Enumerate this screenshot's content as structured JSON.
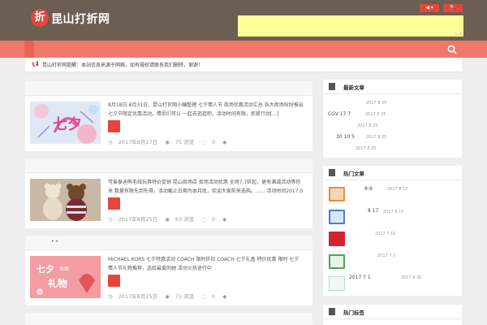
{
  "header": {
    "logo_badge": "折",
    "logo_text": "昆山打折网",
    "lang_button": "◀ ▾",
    "user_button": "🔍"
  },
  "notice": {
    "text": "昆山打折网提醒：本站信息来源于网络，如有侵权请联系我们删除，谢谢！"
  },
  "posts": [
    {
      "head": "",
      "excerpt": "8月18日-8月31日，昆山打折网小编整理 七夕情人节 商场优惠活动汇总 各大商场纷纷推出 七夕节限定优惠活动，情侣们可以 一起去逛逛吧，活动时间有限，抓紧行动[...]",
      "date": "2017年8月17日",
      "views": "75 浏览",
      "comments": "0"
    },
    {
      "head": "",
      "excerpt": "可爱泰迪熊毛绒玩具特价促销 昆山商场店 现场活动优惠 全场7.7折起，更有满减活动等你来 数量有限先到先得，活动截止日期为本月底，欢迎大家前来选购。...... 活动时间2017.08.25 ...",
      "date": "2017年8月25日",
      "views": "63 浏览",
      "comments": "0"
    },
    {
      "head": "• •",
      "excerpt": "MICHAEL KORS 七夕特惠活动 COACH 限时折扣 COACH 七夕礼盒 特价优惠 限时 七夕 情人节礼物推荐，送给最爱的她 活动火热进行中",
      "date": "2017年8月25日",
      "views": "71 浏览",
      "comments": "0"
    }
  ],
  "widgets": {
    "latest": {
      "title": "最新文章",
      "items": [
        {
          "text": "",
          "date": "2017 8 25"
        },
        {
          "text": "CGV   17.7",
          "date": "2017 8 25"
        },
        {
          "text": "",
          "date": "2017 8 25"
        },
        {
          "text": "30 10      5",
          "date": "2017 8 25"
        },
        {
          "text": "",
          "date": "2017 8 25"
        }
      ]
    },
    "hot": {
      "title": "热门文章",
      "items": [
        {
          "text": "8-9",
          "date": "2017 8 17"
        },
        {
          "text": "8 17",
          "date": "2017 8 15"
        },
        {
          "text": "",
          "date": "2017 7 10"
        },
        {
          "text": "",
          "date": "2017 7 3"
        },
        {
          "text": "2017 7 1",
          "date": "2017 6 30"
        }
      ]
    },
    "third": {
      "title": "热门标签"
    }
  },
  "colors": {
    "topbar": "#6b5e52",
    "accent": "#e4463c",
    "navbar": "#f0796b",
    "ad": "#ffff99"
  }
}
